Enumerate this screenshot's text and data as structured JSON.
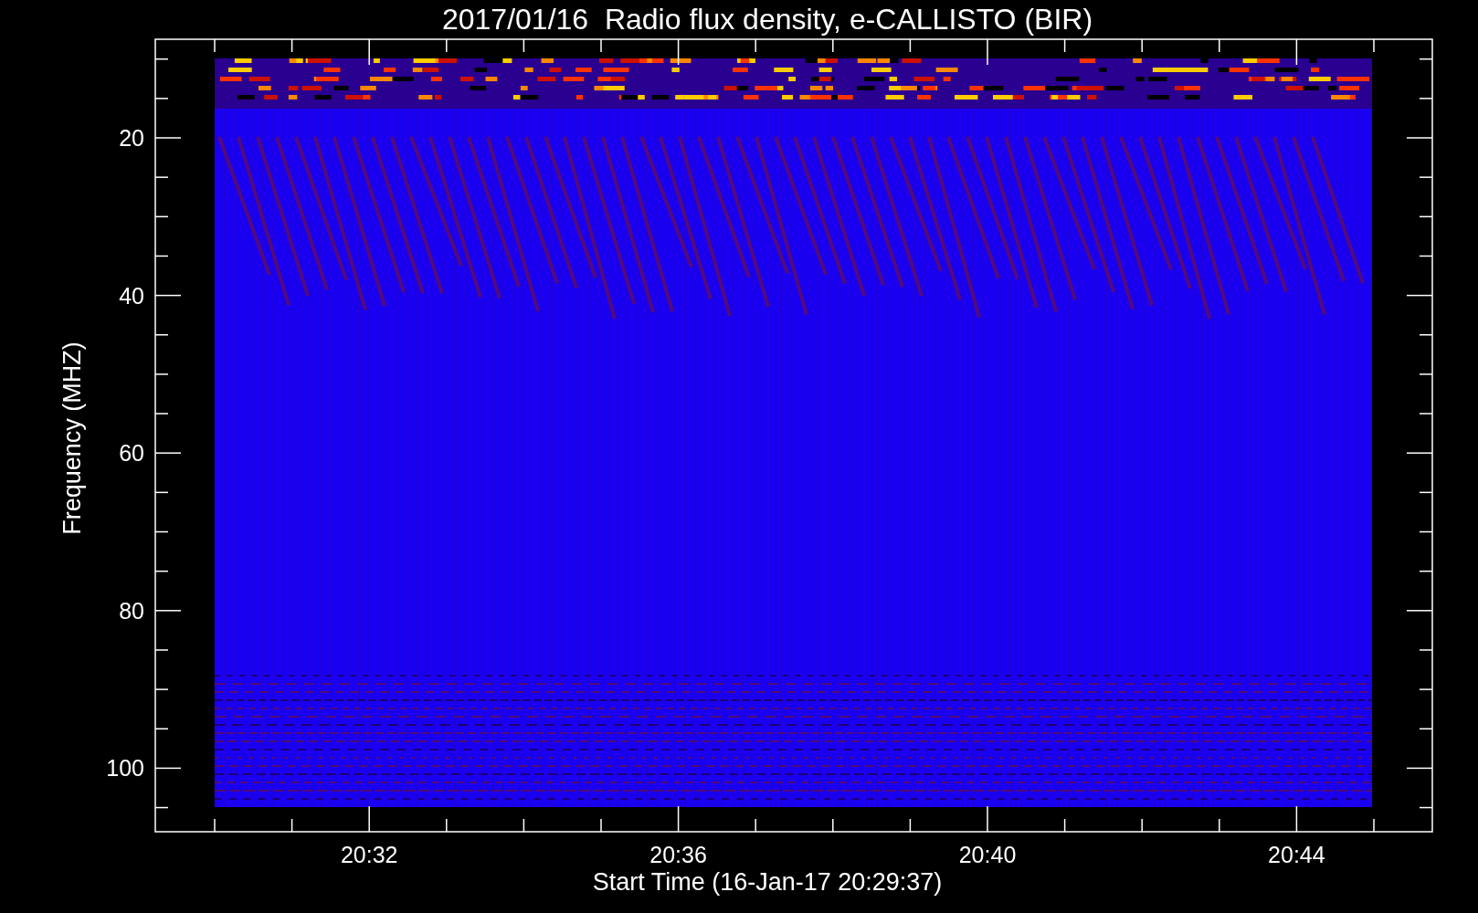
{
  "title": "2017/01/16  Radio flux density, e-CALLISTO (BIR)",
  "plot": {
    "ylabel": "Frequency (MHZ)",
    "xlabel": "Start Time (16-Jan-17 20:29:37)",
    "yticks": [
      "20",
      "40",
      "60",
      "80",
      "100"
    ],
    "xticks": [
      "20:32",
      "20:36",
      "20:40",
      "20:44"
    ]
  }
}
